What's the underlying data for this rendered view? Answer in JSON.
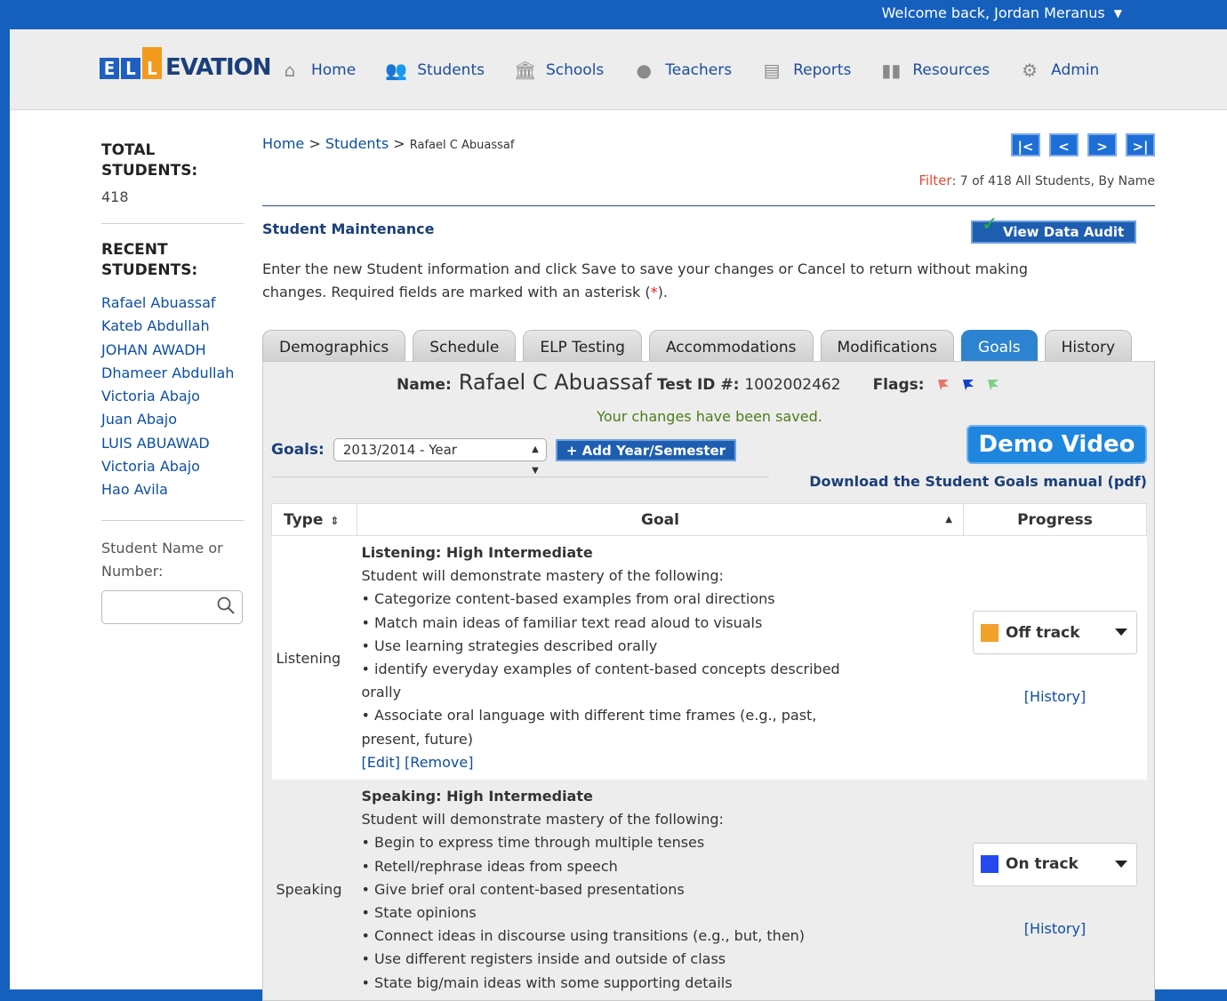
{
  "topbar": {
    "welcome": "Welcome back, Jordan Meranus"
  },
  "logo": {
    "l1": "E",
    "l2": "L",
    "l3": "L",
    "rest": "EVATION"
  },
  "nav": [
    {
      "label": "Home",
      "icon": "home-icon"
    },
    {
      "label": "Students",
      "icon": "students-icon"
    },
    {
      "label": "Schools",
      "icon": "school-icon"
    },
    {
      "label": "Teachers",
      "icon": "apple-icon"
    },
    {
      "label": "Reports",
      "icon": "reports-icon"
    },
    {
      "label": "Resources",
      "icon": "book-icon"
    },
    {
      "label": "Admin",
      "icon": "gear-icon"
    }
  ],
  "sidebar": {
    "total_label": "TOTAL STUDENTS:",
    "total_count": "418",
    "recent_label": "RECENT STUDENTS:",
    "recent": [
      "Rafael Abuassaf",
      "Kateb Abdullah",
      "JOHAN AWADH",
      "Dhameer Abdullah",
      "Victoria Abajo",
      "Juan Abajo",
      "LUIS ABUAWAD",
      "Victoria Abajo",
      "Hao Avila"
    ],
    "search_label": "Student Name or Number:",
    "search_value": ""
  },
  "breadcrumb": {
    "home": "Home",
    "sep1": ">",
    "students": "Students",
    "sep2": ">",
    "current": "Rafael C Abuassaf"
  },
  "pager": {
    "first": "|<",
    "prev": "<",
    "next": ">",
    "last": ">|"
  },
  "filter": {
    "label": "Filter",
    "text": ": 7 of 418 All Students, By Name"
  },
  "page": {
    "title": "Student Maintenance",
    "audit_button": "View Data Audit",
    "intro": "Enter the new Student information and click Save to save your changes or Cancel to return without making changes. Required fields are marked with an asterisk (",
    "intro_ast": "*",
    "intro_end": ")."
  },
  "tabs": [
    "Demographics",
    "Schedule",
    "ELP Testing",
    "Accommodations",
    "Modifications",
    "Goals",
    "History"
  ],
  "student": {
    "name_label": "Name:",
    "name": "Rafael C Abuassaf",
    "testid_label": "Test ID #:",
    "testid": "1002002462",
    "flags_label": "Flags:",
    "flag_colors": [
      "#e8756a",
      "#1040d0",
      "#7fd08a"
    ]
  },
  "saved_message": "Your changes have been saved.",
  "goals": {
    "label": "Goals:",
    "selected": "2013/2014 - Year",
    "add_button": "+ Add Year/Semester",
    "demo_button": "Demo Video",
    "manual_link": "Download the Student Goals manual (pdf)",
    "headers": {
      "type": "Type",
      "goal": "Goal",
      "progress": "Progress"
    },
    "rows": [
      {
        "type": "Listening",
        "title": "Listening: High Intermediate",
        "intro": "Student will demonstrate mastery of the following:",
        "bullets": [
          "Categorize content-based examples from oral directions",
          "Match main ideas of familiar text read aloud to visuals",
          "Use learning strategies described orally",
          "identify everyday examples of content-based concepts described orally",
          "Associate oral language with different time frames (e.g., past, present, future)"
        ],
        "actions": "[Edit] [Remove]",
        "progress": "Off track",
        "progress_color": "#f2a12a",
        "history": "[History]"
      },
      {
        "type": "Speaking",
        "title": "Speaking: High Intermediate",
        "intro": "Student will demonstrate mastery of the following:",
        "bullets": [
          "Begin to express time through multiple tenses",
          "Retell/rephrase ideas from speech",
          "Give brief oral content-based presentations",
          "State opinions",
          "Connect ideas in discourse using transitions (e.g., but, then)",
          "Use different registers inside and outside of class",
          "State big/main ideas with some supporting details"
        ],
        "progress": "On track",
        "progress_color": "#2449f0",
        "history": "[History]"
      }
    ]
  }
}
